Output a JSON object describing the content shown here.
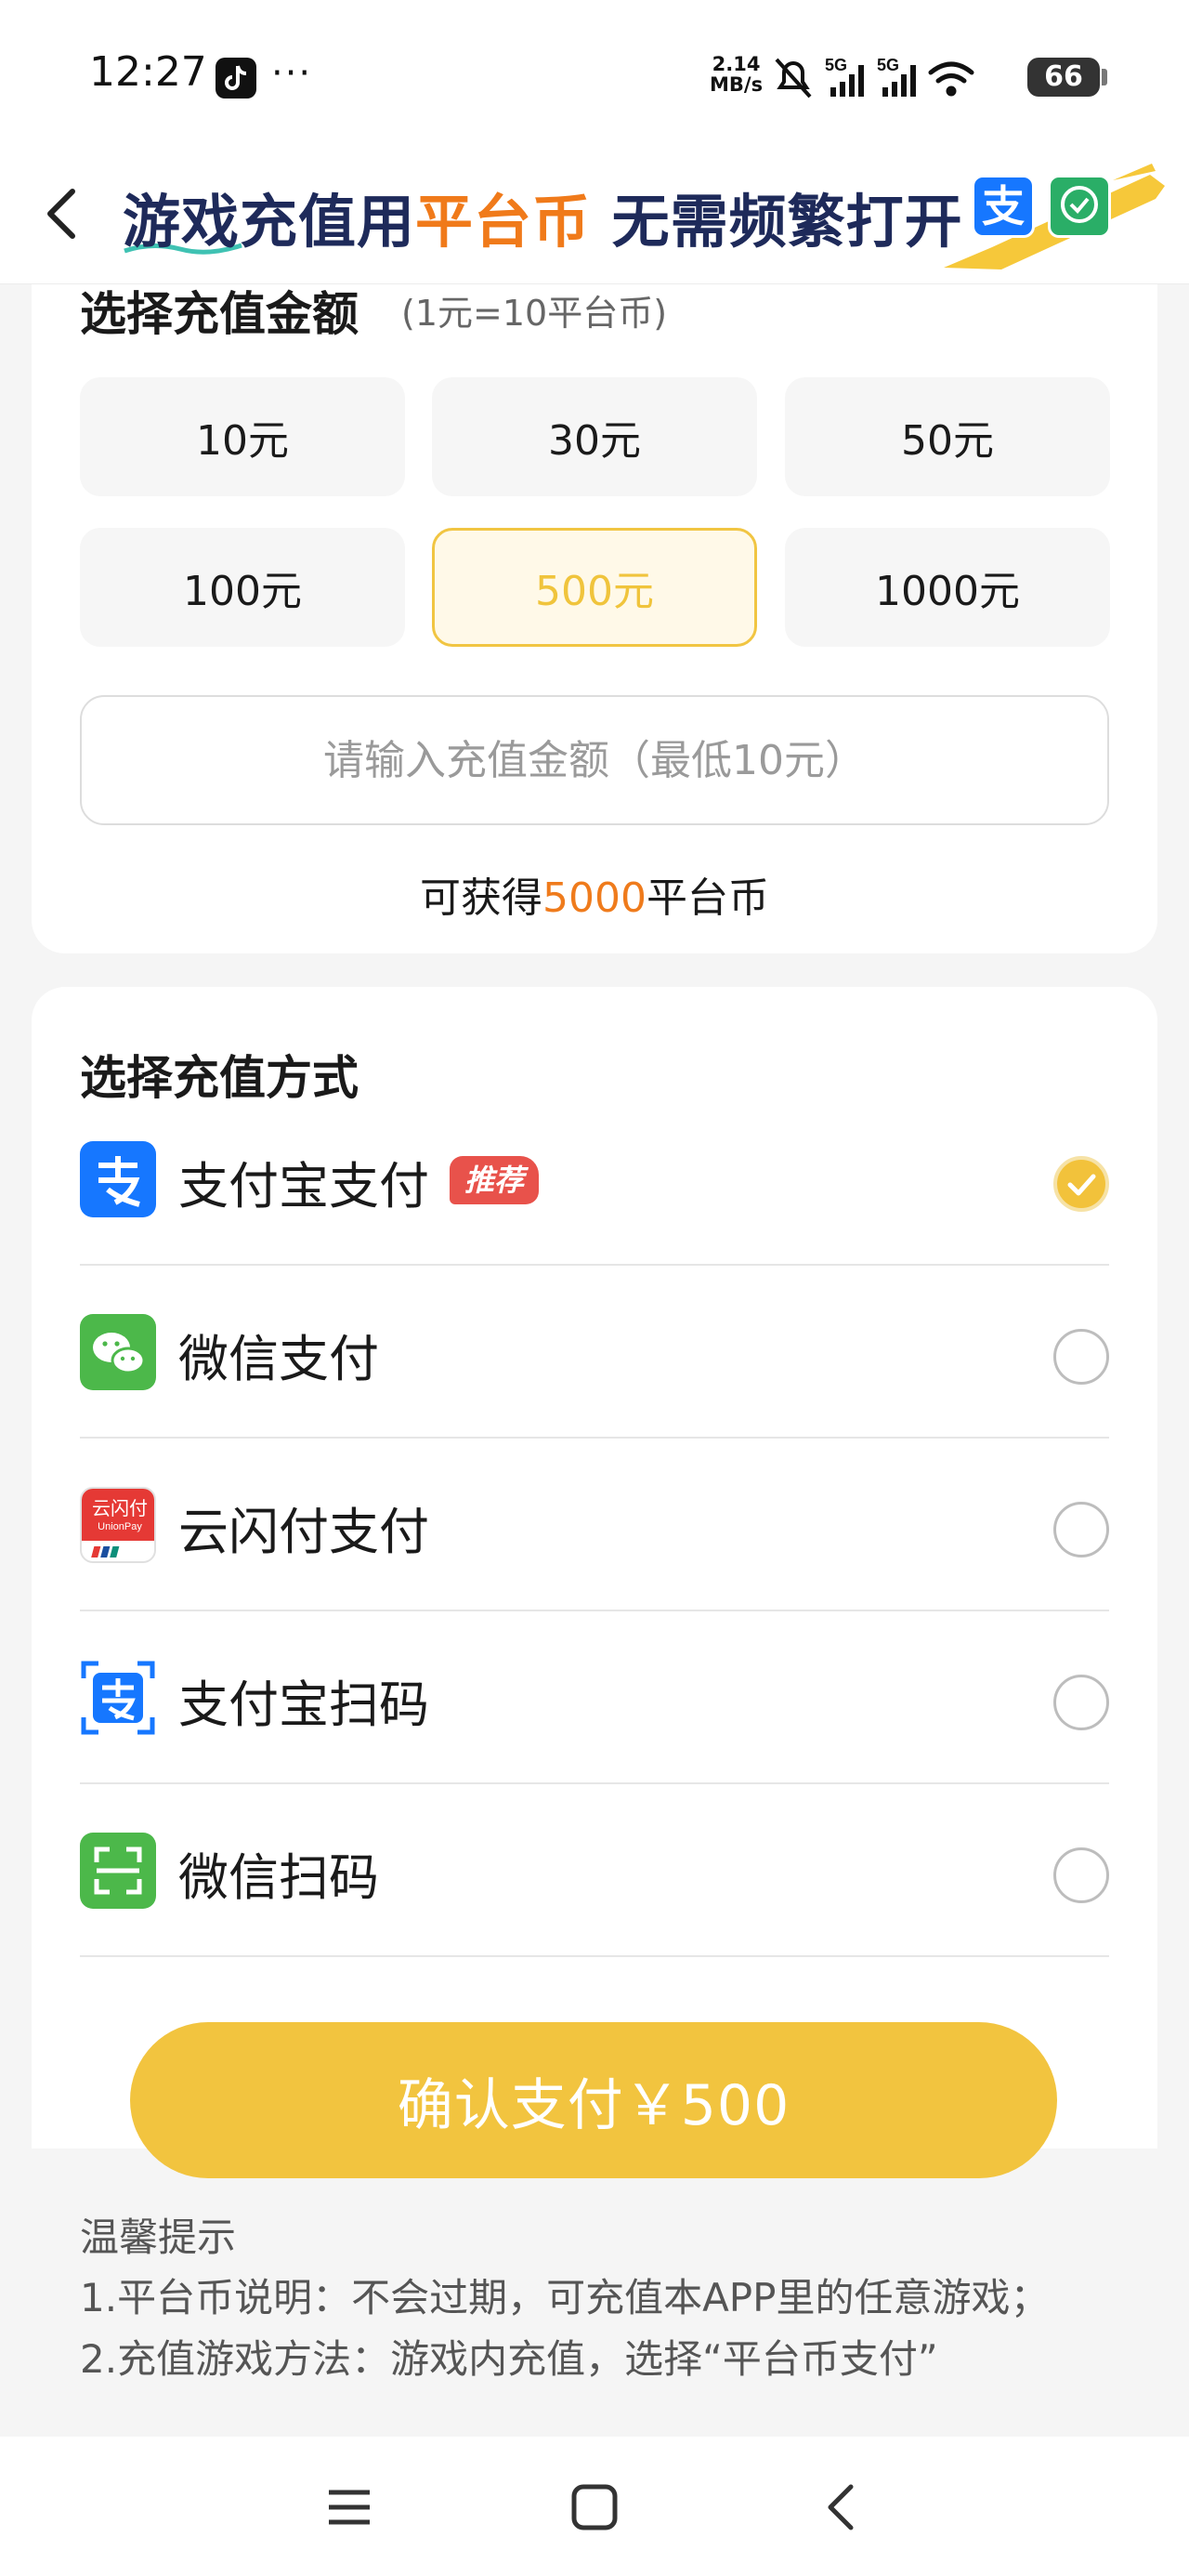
{
  "status_bar": {
    "time": "12:27",
    "dots": "···",
    "net_speed_value": "2.14",
    "net_speed_unit": "MB/s",
    "network_1": "5G",
    "network_2": "5G",
    "battery": "66"
  },
  "header": {
    "banner_part1": "游戏充值用",
    "banner_accent": "平台币",
    "banner_part2": " 无需频繁打开",
    "alipay_badge": "支"
  },
  "amount_section": {
    "title": "选择充值金额",
    "subtitle": "(1元=10平台币)",
    "options": [
      {
        "label": "10元",
        "selected": false
      },
      {
        "label": "30元",
        "selected": false
      },
      {
        "label": "50元",
        "selected": false
      },
      {
        "label": "100元",
        "selected": false
      },
      {
        "label": "500元",
        "selected": true
      },
      {
        "label": "1000元",
        "selected": false
      }
    ],
    "custom_placeholder": "请输入充值金额（最低10元）",
    "coins_prefix": "可获得",
    "coins_value": "5000",
    "coins_suffix": "平台币"
  },
  "payment_section": {
    "title": "选择充值方式",
    "methods": [
      {
        "label": "支付宝支付",
        "icon": "alipay-icon",
        "badge": "推荐",
        "checked": true
      },
      {
        "label": "微信支付",
        "icon": "wechat-icon",
        "checked": false
      },
      {
        "label": "云闪付支付",
        "icon": "unionpay-icon",
        "icon_text_cn": "云闪付",
        "icon_text_en": "UnionPay",
        "checked": false
      },
      {
        "label": "支付宝扫码",
        "icon": "alipay-scan-icon",
        "checked": false
      },
      {
        "label": "微信扫码",
        "icon": "wechat-scan-icon",
        "checked": false
      }
    ]
  },
  "confirm": {
    "label": "确认支付￥500"
  },
  "tips": {
    "title": "温馨提示",
    "line1": "1.平台币说明：不会过期，可充值本APP里的任意游戏；",
    "line2": "2.充值游戏方法：游戏内充值，选择“平台币支付”"
  },
  "colors": {
    "accent_yellow": "#f2c43f",
    "accent_orange": "#ef7b1c",
    "alipay_blue": "#1677ff",
    "wechat_green": "#2aae67",
    "unionpay_red": "#e53935",
    "recommend_red": "#e8524b"
  }
}
